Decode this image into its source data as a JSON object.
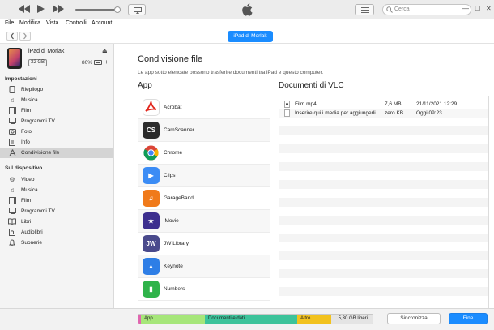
{
  "toolbar": {
    "search_placeholder": "Cerca",
    "window_controls": [
      "—",
      "☐",
      "✕"
    ]
  },
  "menubar": {
    "items": [
      "File",
      "Modifica",
      "Vista",
      "Controlli",
      "Account"
    ]
  },
  "nav": {
    "device_button": "iPad di Morlak"
  },
  "device": {
    "name": "iPad di Morlak",
    "capacity": "32 GB",
    "battery": "80%"
  },
  "sidebar": {
    "settings_header": "Impostazioni",
    "settings_items": [
      {
        "label": "Riepilogo",
        "icon": "summary-icon"
      },
      {
        "label": "Musica",
        "icon": "music-note-icon"
      },
      {
        "label": "Film",
        "icon": "film-icon"
      },
      {
        "label": "Programmi TV",
        "icon": "tv-icon"
      },
      {
        "label": "Foto",
        "icon": "camera-icon"
      },
      {
        "label": "Info",
        "icon": "info-icon"
      },
      {
        "label": "Condivisione file",
        "icon": "file-sharing-icon"
      }
    ],
    "device_header": "Sul dispositivo",
    "device_items": [
      {
        "label": "Video",
        "icon": "video-gear-icon"
      },
      {
        "label": "Musica",
        "icon": "music-note-icon"
      },
      {
        "label": "Film",
        "icon": "film-icon"
      },
      {
        "label": "Programmi TV",
        "icon": "tv-icon"
      },
      {
        "label": "Libri",
        "icon": "book-icon"
      },
      {
        "label": "Audiolibri",
        "icon": "audiobook-icon"
      },
      {
        "label": "Suonerie",
        "icon": "bell-icon"
      }
    ]
  },
  "main": {
    "title": "Condivisione file",
    "subtitle": "Le app sotto elencate possono trasferire documenti tra iPad e questo computer.",
    "apps_header": "App",
    "docs_header": "Documenti di VLC",
    "apps": [
      {
        "label": "Acrobat",
        "color": "#e1251b",
        "glyph": "A"
      },
      {
        "label": "CamScanner",
        "color": "#2b2b2b",
        "glyph": "CS"
      },
      {
        "label": "Chrome",
        "color": "#ffffff",
        "glyph": ""
      },
      {
        "label": "Clips",
        "color": "#3b8cf5",
        "glyph": "▶"
      },
      {
        "label": "GarageBand",
        "color": "#f07a1a",
        "glyph": "♫"
      },
      {
        "label": "iMovie",
        "color": "#3d2f8f",
        "glyph": "★"
      },
      {
        "label": "JW Library",
        "color": "#4a4a8c",
        "glyph": "JW"
      },
      {
        "label": "Keynote",
        "color": "#2e7ee6",
        "glyph": "▲"
      },
      {
        "label": "Numbers",
        "color": "#2fb34a",
        "glyph": "▮"
      }
    ],
    "documents": [
      {
        "name": "Film.mp4",
        "size": "7,6 MB",
        "date": "21/11/2021 12:29",
        "type": "media"
      },
      {
        "name": "Inserire qui i media per aggiungerli",
        "size": "zero KB",
        "date": "Oggi 09:23",
        "type": "file"
      }
    ]
  },
  "storage": {
    "segments": [
      {
        "label": "App",
        "color": "#a6e67a"
      },
      {
        "label": "Documenti e dati",
        "color": "#3cc39a"
      },
      {
        "label": "Altro",
        "color": "#f2c21e"
      },
      {
        "label": "5,30 GB liberi",
        "color": "#e4e4e4"
      }
    ]
  },
  "buttons": {
    "sync": "Sincronizza",
    "done": "Fine"
  }
}
